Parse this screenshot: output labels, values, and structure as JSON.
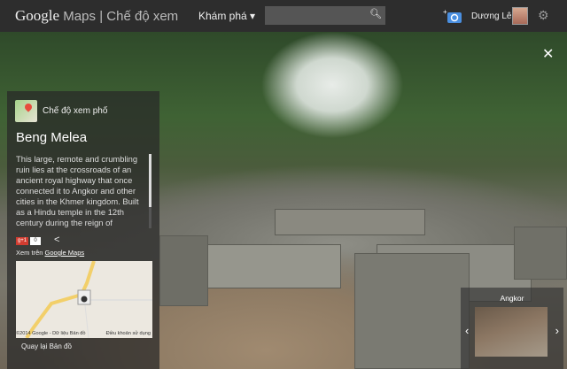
{
  "topbar": {
    "logo": "Google",
    "logo_maps": "Maps",
    "logo_mode": "| Chế độ xem",
    "explore": "Khám phá ▾",
    "search_placeholder": "",
    "user_name": "Dương Lê"
  },
  "panel": {
    "mode_label": "Chế độ xem phố",
    "title": "Beng Melea",
    "description": "This large, remote and crumbling ruin lies at the crossroads of an ancient royal highway that once connected it to Angkor and other cities in the Khmer kingdom. Built as a Hindu temple in the 12th century during the reign of Suryavarman II, it's believed to",
    "gplus_label": "g+1",
    "gplus_count": "0",
    "view_on_prefix": "Xem trên ",
    "view_on_link": "Google Maps",
    "map_copyright": "©2014 Google - Dữ liệu Bản đồ",
    "map_terms": "Điều khoản sử dụng",
    "back_label": "Quay lại Bản đồ"
  },
  "nearby": {
    "title": "Angkor"
  },
  "colors": {
    "topbar": "#2d2d2d",
    "gplus": "#d23c30",
    "road": "#f2cf6a"
  }
}
